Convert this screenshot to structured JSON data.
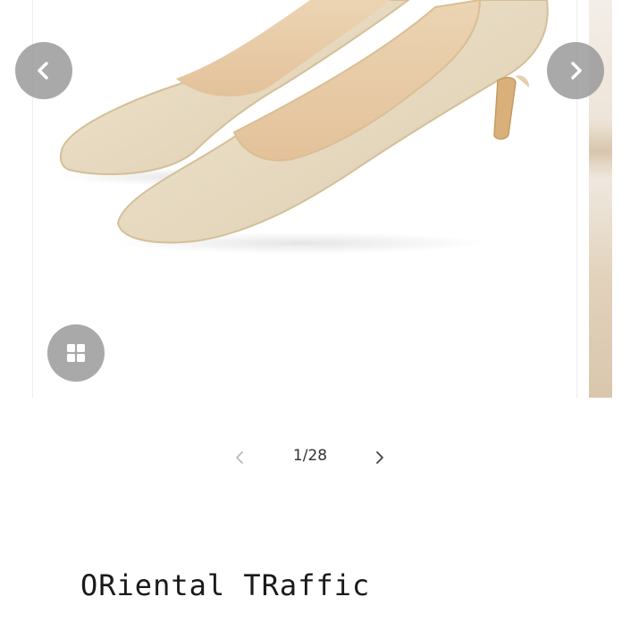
{
  "gallery": {
    "photo_alt": "gold glitter pointed-toe pumps",
    "pager": {
      "counter": "1/28"
    }
  },
  "product": {
    "title": "ORiental TRaffic"
  },
  "icons": {
    "prev": "chevron-left-icon",
    "next": "chevron-right-icon",
    "grid": "grid-icon"
  },
  "colors": {
    "nav_circle": "#969696",
    "shoe_gold": "#e8dcc4",
    "text": "#1a1a1a"
  }
}
